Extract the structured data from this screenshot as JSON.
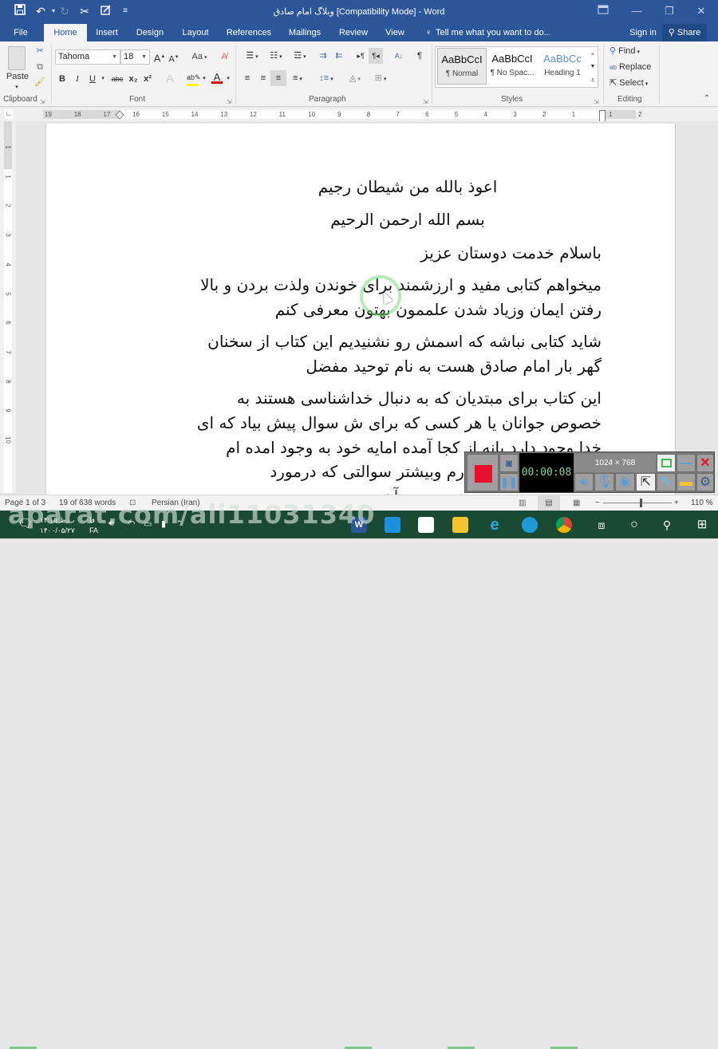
{
  "window": {
    "title": "وبلاگ امام صادق [Compatibility Mode] - Word",
    "quick_access": [
      "save-icon",
      "undo-icon",
      "redo-icon",
      "cut-icon",
      "touch-mode-icon",
      "customize-icon"
    ],
    "controls": [
      "ribbon-display-icon",
      "minimize-icon",
      "restore-icon",
      "close-icon"
    ]
  },
  "tabs": {
    "file": "File",
    "home": "Home",
    "insert": "Insert",
    "design": "Design",
    "layout": "Layout",
    "references": "References",
    "mailings": "Mailings",
    "review": "Review",
    "view": "View",
    "tell_me": "Tell me what you want to do...",
    "sign_in": "Sign in",
    "share": "Share"
  },
  "ribbon": {
    "clipboard": {
      "label": "Clipboard",
      "paste": "Paste"
    },
    "font": {
      "label": "Font",
      "font_name": "Tahoma",
      "font_size": "18",
      "change_case": "Aa",
      "bold": "B",
      "italic": "I",
      "underline": "U",
      "strikethrough": "abc",
      "subscript": "x₂",
      "superscript": "x²",
      "highlight_color": "#ffff00",
      "font_color": "#e00000"
    },
    "paragraph": {
      "label": "Paragraph"
    },
    "styles": {
      "label": "Styles",
      "items": [
        {
          "sample": "AaBbCcI",
          "name": "¶ Normal",
          "selected": true
        },
        {
          "sample": "AaBbCcI",
          "name": "¶ No Spac...",
          "selected": false
        },
        {
          "sample": "AaBbCc",
          "name": "Heading 1",
          "selected": false
        }
      ]
    },
    "editing": {
      "label": "Editing",
      "find": "Find",
      "replace": "Replace",
      "select": "Select"
    }
  },
  "ruler": {
    "horizontal": [
      "19",
      "18",
      "17",
      "16",
      "15",
      "14",
      "13",
      "12",
      "11",
      "10",
      "9",
      "8",
      "7",
      "6",
      "5",
      "4",
      "3",
      "2",
      "1",
      "1",
      "2"
    ],
    "vertical": [
      "1",
      "1",
      "2",
      "3",
      "4",
      "5",
      "6",
      "7",
      "8",
      "9",
      "10"
    ]
  },
  "document": {
    "lines": [
      "اعوذ بالله من شیطان رجیم",
      "بسم الله ارحمن الرحیم",
      "باسلام  خدمت دوستان عزیز",
      "میخواهم کتابی مفید و ارزشمند برای خوندن ولذت بردن و بالا",
      "رفتن ایمان وزیاد شدن علممون بهتون معرفی کنم",
      "شاید کتابی نباشه که اسمش رو نشنیدیم  این کتاب از سخنان",
      "گهر بار امام صادق هست به نام توحید مفضل",
      "این کتاب برای مبتدیان که به دنبال خداشناسی هستند  به",
      "خصوص جوانان یا هر کسی که برای ش سوال پیش بیاد که ای",
      "خدا وجود دارد یانه از کجا آمده امایه خود به وجود امده ام",
      "یانا دارم وبیشتر سوالتی که درمورد",
      "...وجود آن"
    ]
  },
  "status": {
    "page": "Page 1 of 3",
    "words": "19 of 638 words",
    "language": "Persian (Iran)",
    "zoom": "110 %",
    "zoom_level_percent": 110
  },
  "recorder": {
    "timer": "00:00:08",
    "resolution": "1024 × 768"
  },
  "taskbar": {
    "time": "۱۴:۱۵ ب.ظ",
    "date": "۱۴۰۰/۰۵/۲۷",
    "lang_top": "فا",
    "lang": "FA",
    "watermark": "aparat.com/ali11031340"
  }
}
